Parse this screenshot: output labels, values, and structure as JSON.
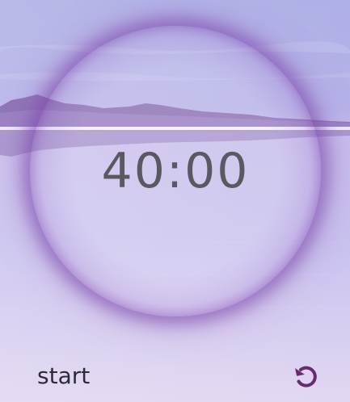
{
  "timer": {
    "display": "40:00"
  },
  "controls": {
    "start_label": "start",
    "reset_icon": "reset-icon"
  },
  "colors": {
    "accent": "#6a2a6e",
    "ring": "#7a46aa",
    "text": "#5b5862",
    "sky_top": "#b7b6e8",
    "water_bottom": "#ddd2f0"
  }
}
